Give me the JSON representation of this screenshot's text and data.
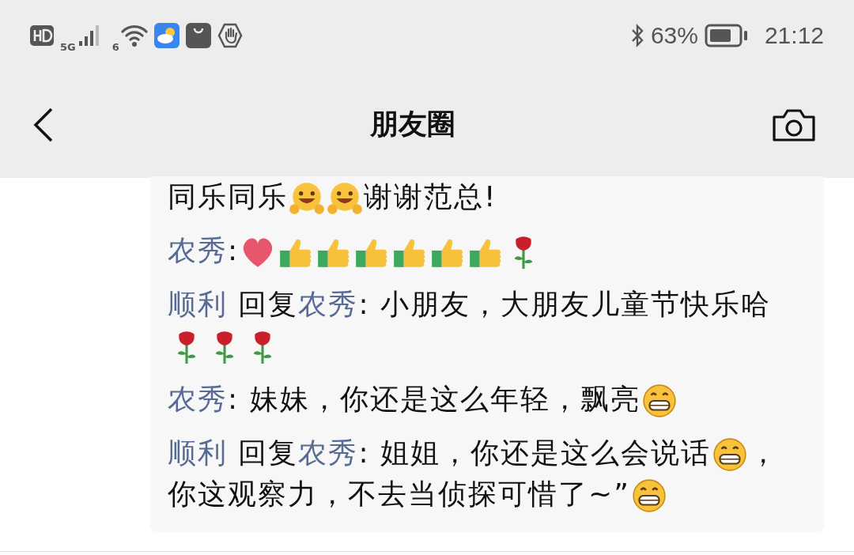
{
  "status_bar": {
    "network": "5G",
    "wifi": "6",
    "battery": "63%",
    "time": "21:12"
  },
  "nav": {
    "title": "朋友圈"
  },
  "comments": [
    {
      "parts": [
        {
          "kind": "text",
          "text": "同乐同乐"
        },
        {
          "kind": "hug"
        },
        {
          "kind": "hug"
        },
        {
          "kind": "text",
          "text": "谢谢范总!"
        }
      ]
    },
    {
      "author": "农秀",
      "parts": [
        {
          "kind": "text",
          "text": ": "
        },
        {
          "kind": "heart"
        },
        {
          "kind": "thumb"
        },
        {
          "kind": "thumb"
        },
        {
          "kind": "thumb"
        },
        {
          "kind": "thumb"
        },
        {
          "kind": "thumb"
        },
        {
          "kind": "thumb"
        },
        {
          "kind": "rose"
        }
      ]
    },
    {
      "author": "顺利",
      "reply_word": "回复",
      "reply_to": "农秀",
      "parts": [
        {
          "kind": "text",
          "text": ": 小朋友，大朋友儿童节快乐哈"
        },
        {
          "kind": "rose"
        },
        {
          "kind": "rose"
        },
        {
          "kind": "rose"
        }
      ]
    },
    {
      "author": "农秀",
      "parts": [
        {
          "kind": "text",
          "text": ": 妹妹，你还是这么年轻，飘亮"
        },
        {
          "kind": "grin"
        }
      ]
    },
    {
      "author": "顺利",
      "reply_word": "回复",
      "reply_to": "农秀",
      "parts": [
        {
          "kind": "text",
          "text": ": 姐姐，你还是这么会说话"
        },
        {
          "kind": "grin"
        },
        {
          "kind": "text",
          "text": "，"
        },
        {
          "kind": "text",
          "text": "你这观察力，不去当侦探可惜了~”"
        },
        {
          "kind": "grin"
        }
      ]
    }
  ]
}
